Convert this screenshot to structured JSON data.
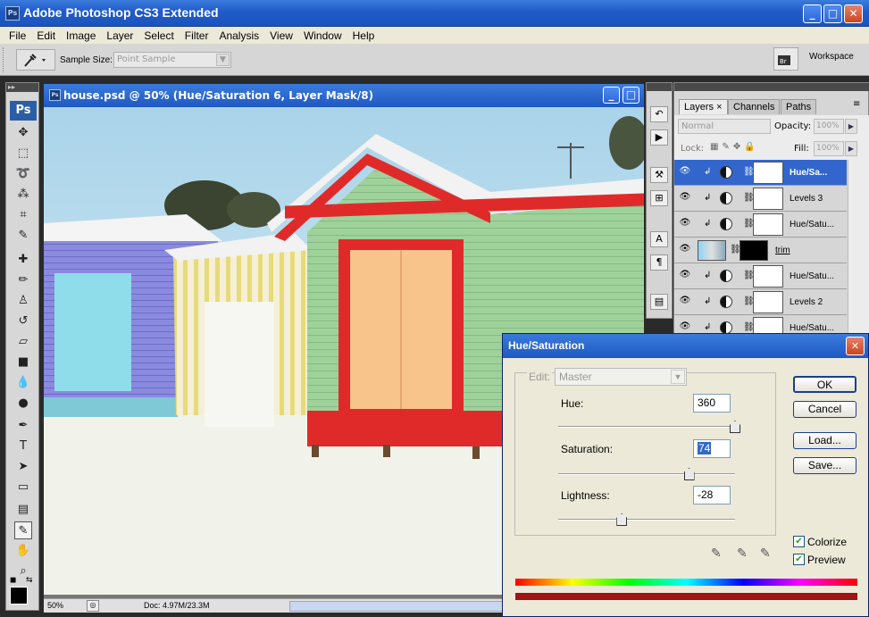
{
  "app": {
    "title": "Adobe Photoshop CS3 Extended",
    "icon_text": "Ps"
  },
  "window_controls": {
    "minimize": "_",
    "maximize": "□",
    "close": "✕"
  },
  "menu": [
    "File",
    "Edit",
    "Image",
    "Layer",
    "Select",
    "Filter",
    "Analysis",
    "View",
    "Window",
    "Help"
  ],
  "options_bar": {
    "sample_size_label": "Sample Size:",
    "sample_size_value": "Point Sample",
    "workspace_label": "Workspace"
  },
  "toolbox": {
    "logo": "Ps",
    "header": "▸▸"
  },
  "document": {
    "title": "house.psd @ 50% (Hue/Saturation 6, Layer Mask/8)",
    "icon_text": "Ps",
    "zoom": "50%",
    "doc_info": "Doc: 4.97M/23.3M"
  },
  "layers_panel": {
    "tabs": [
      "Layers",
      "Channels",
      "Paths"
    ],
    "blend_mode": "Normal",
    "opacity_label": "Opacity:",
    "opacity_value": "100%",
    "lock_label": "Lock:",
    "fill_label": "Fill:",
    "fill_value": "100%",
    "layers": [
      {
        "name": "Hue/Sa...",
        "selected": true
      },
      {
        "name": "Levels 3",
        "selected": false
      },
      {
        "name": "Hue/Satu...",
        "selected": false
      },
      {
        "name": "trim",
        "selected": false
      },
      {
        "name": "Hue/Satu...",
        "selected": false
      },
      {
        "name": "Levels 2",
        "selected": false
      },
      {
        "name": "Hue/Satu...",
        "selected": false
      }
    ]
  },
  "hue_saturation": {
    "title": "Hue/Saturation",
    "edit_label": "Edit:",
    "edit_value": "Master",
    "hue_label": "Hue:",
    "hue_value": "360",
    "saturation_label": "Saturation:",
    "saturation_value": "74",
    "lightness_label": "Lightness:",
    "lightness_value": "-28",
    "hue_level": 1.0,
    "saturation_level": 0.74,
    "lightness_level": 0.36,
    "buttons": {
      "ok": "OK",
      "cancel": "Cancel",
      "load": "Load...",
      "save": "Save..."
    },
    "colorize_label": "Colorize",
    "colorize_checked": true,
    "preview_label": "Preview",
    "preview_checked": true,
    "result_color": "#a01414"
  },
  "colors": {
    "title_blue": "#2660d0",
    "panel_gray": "#d6d6d6",
    "selection_blue": "#3366cc"
  }
}
